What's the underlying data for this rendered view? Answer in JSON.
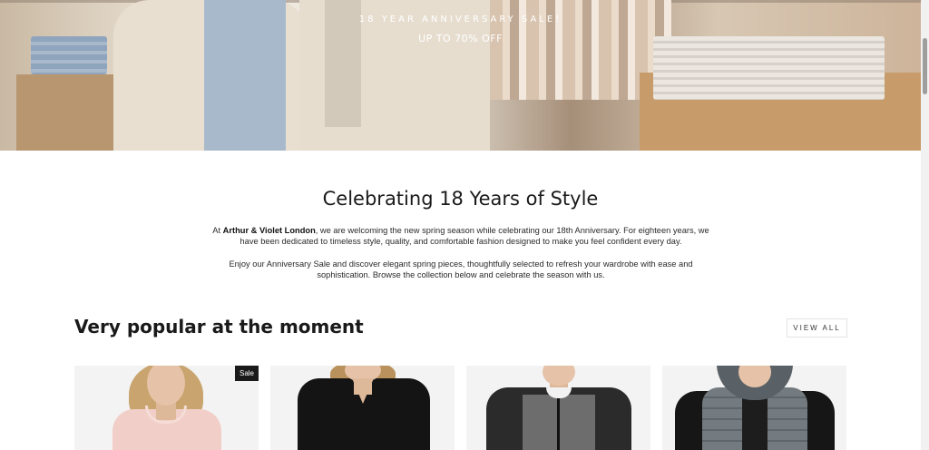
{
  "hero": {
    "kicker": "18 YEAR ANNIVERSARY SALE!",
    "offer": "UP TO 70% OFF"
  },
  "intro": {
    "title": "Celebrating 18 Years of Style",
    "p1_prefix": "At ",
    "p1_brand": "Arthur & Violet London",
    "p1_rest": ", we are welcoming the new spring season while celebrating our 18th Anniversary. For eighteen years, we have been dedicated to timeless style, quality, and comfortable fashion designed to make you feel confident every day.",
    "p2": "Enjoy our Anniversary Sale and discover elegant spring pieces, thoughtfully selected to refresh your wardrobe with ease and sophistication. Browse the collection below and celebrate the season with us."
  },
  "popular": {
    "title": "Very popular at the moment",
    "view_all_label": "VIEW ALL",
    "products": [
      {
        "badge": "Sale",
        "icon": "pink-scallop-top"
      },
      {
        "badge": null,
        "icon": "black-blouse"
      },
      {
        "badge": null,
        "icon": "grey-black-zip-jacket"
      },
      {
        "badge": null,
        "icon": "grey-puffer-vest"
      }
    ]
  }
}
